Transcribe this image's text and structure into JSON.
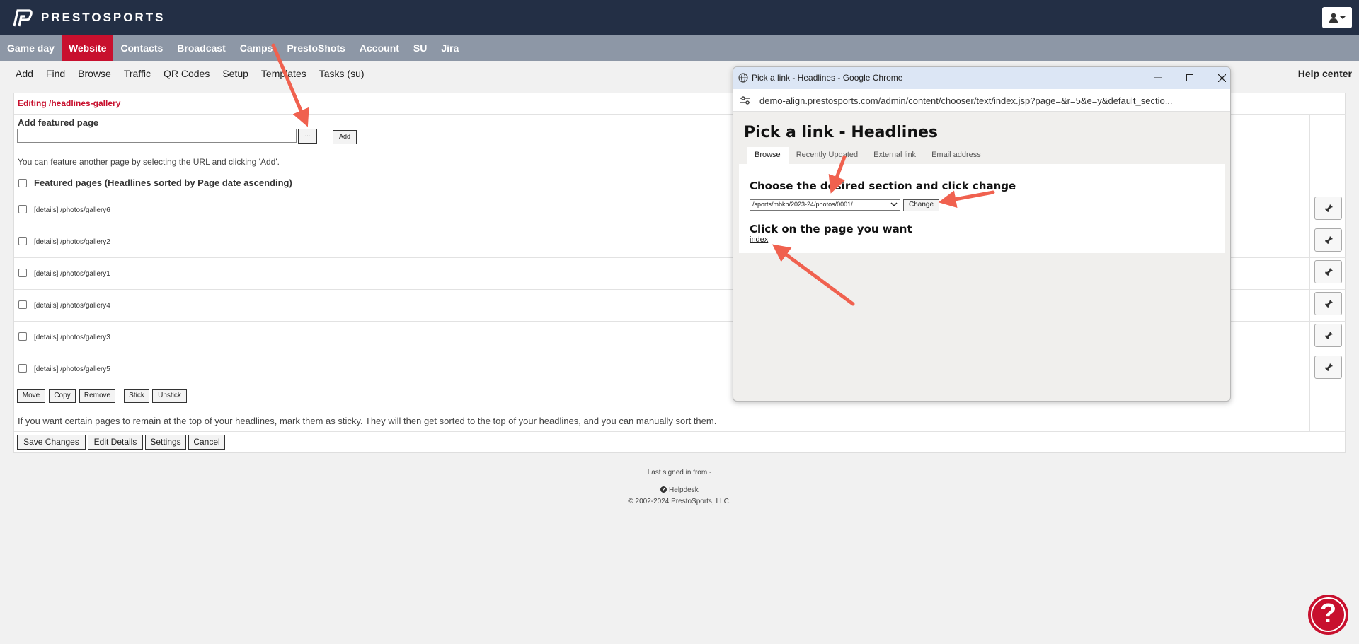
{
  "brand": {
    "name": "PRESTOSPORTS"
  },
  "main_nav": [
    "Game day",
    "Website",
    "Contacts",
    "Broadcast",
    "Camps",
    "PrestoShots",
    "Account",
    "SU",
    "Jira"
  ],
  "main_nav_active": "Website",
  "sub_nav": [
    "Add",
    "Find",
    "Browse",
    "Traffic",
    "QR Codes",
    "Setup",
    "Templates",
    "Tasks (su)"
  ],
  "help_center": "Help center",
  "editor": {
    "title": "Editing /headlines-gallery",
    "add_label": "Add featured page",
    "add_input_value": "",
    "browse_label": "...",
    "add_button": "Add",
    "help_text": "You can feature another page by selecting the URL and clicking 'Add'.",
    "list_header": "Featured pages (Headlines sorted by Page date ascending)",
    "items": [
      "[details] /photos/gallery6",
      "[details] /photos/gallery2",
      "[details] /photos/gallery1",
      "[details] /photos/gallery4",
      "[details] /photos/gallery3",
      "[details] /photos/gallery5"
    ],
    "actions": [
      "Move",
      "Copy",
      "Remove",
      "Stick",
      "Unstick"
    ],
    "sticky_text": "If you want certain pages to remain at the top of your headlines, mark them as sticky. They will then get sorted to the top of your headlines, and you can manually sort them.",
    "bottom_buttons": [
      "Save Changes",
      "Edit Details",
      "Settings",
      "Cancel"
    ]
  },
  "footer": {
    "last_signed": "Last signed in from -",
    "helpdesk": "Helpdesk",
    "copyright": "© 2002-2024 PrestoSports, LLC."
  },
  "help_fab": "?",
  "popup": {
    "window_title": "Pick a link - Headlines - Google Chrome",
    "url": "demo-align.prestosports.com/admin/content/chooser/text/index.jsp?page=&r=5&e=y&default_sectio...",
    "heading": "Pick a link - Headlines",
    "tabs": [
      "Browse",
      "Recently Updated",
      "External link",
      "Email address"
    ],
    "active_tab": "Browse",
    "choose_heading": "Choose the desired section and click change",
    "section_value": "/sports/mbkb/2023-24/photos/0001/",
    "change_button": "Change",
    "click_heading": "Click on the page you want",
    "page_link": "index"
  },
  "colors": {
    "topbar": "#232f45",
    "nav": "#8d97a6",
    "accent": "#c8102e",
    "annotation_arrow": "#f0614f"
  }
}
